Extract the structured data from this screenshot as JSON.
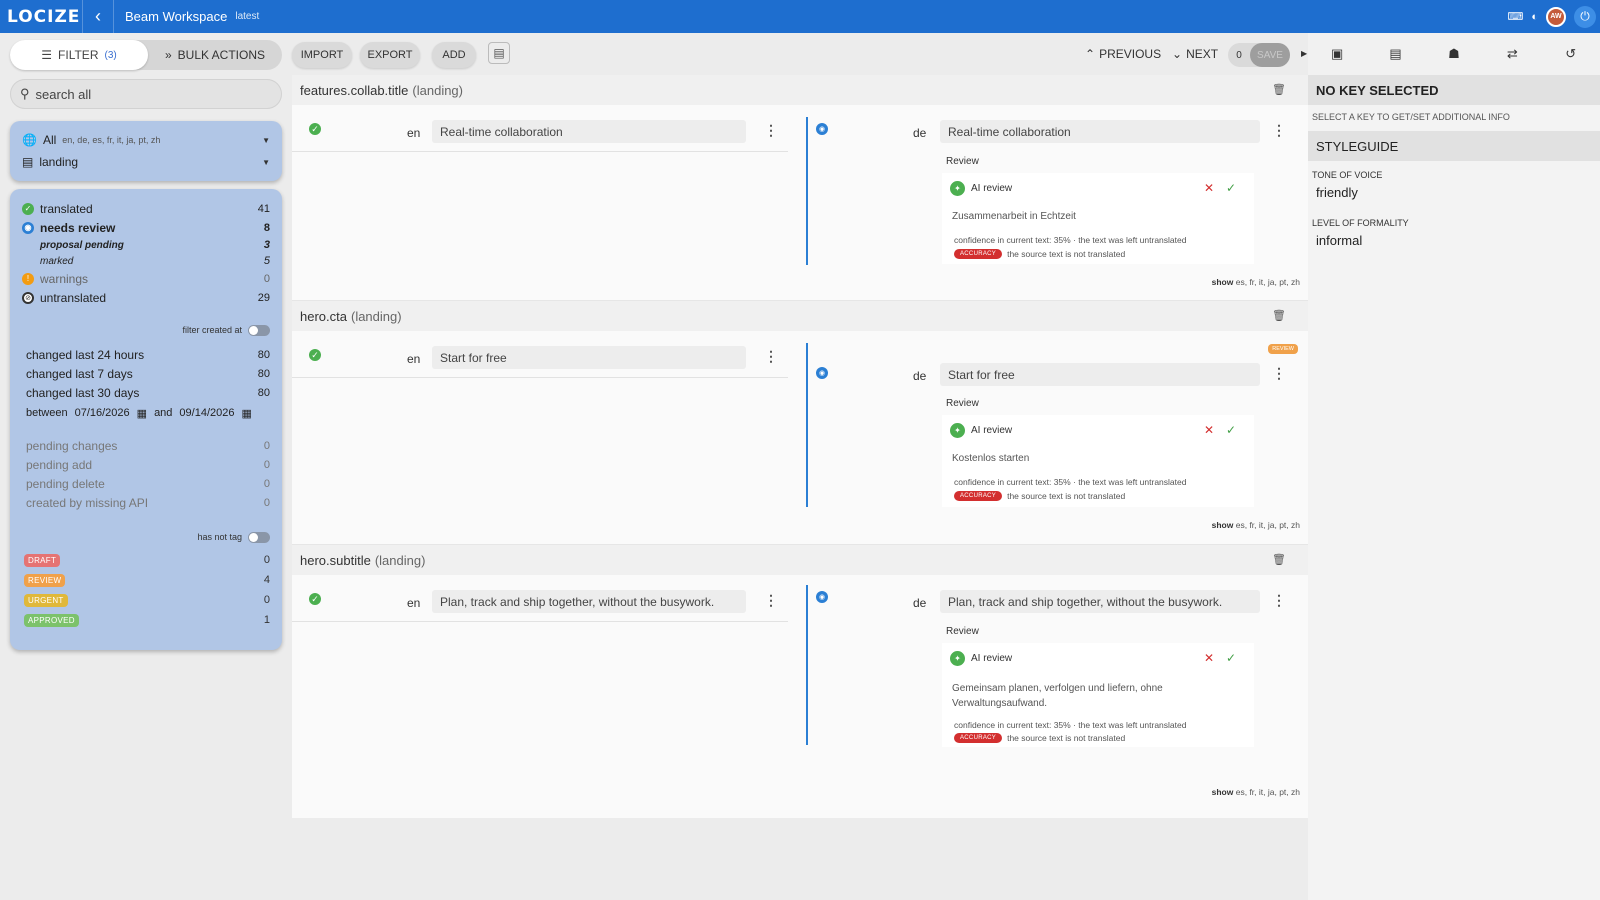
{
  "topbar": {
    "logo": "LOCIZE",
    "project": "Beam Workspace",
    "branch": "latest",
    "avatar_initials": "AW"
  },
  "sidebar": {
    "filter_label": "FILTER",
    "filter_count": "(3)",
    "bulk_label": "BULK ACTIONS",
    "search_placeholder": "search all",
    "lang_all": "All",
    "lang_list": "en, de, es, fr, it, ja, pt, zh",
    "namespace": "landing",
    "status": [
      {
        "label": "translated",
        "count": "41"
      },
      {
        "label": "needs review",
        "count": "8"
      },
      {
        "label": "proposal pending",
        "count": "3"
      },
      {
        "label": "marked",
        "count": "5"
      },
      {
        "label": "warnings",
        "count": "0"
      },
      {
        "label": "untranslated",
        "count": "29"
      }
    ],
    "filter_created_at": "filter created at",
    "changed": [
      {
        "label": "changed last 24 hours",
        "count": "80"
      },
      {
        "label": "changed last 7 days",
        "count": "80"
      },
      {
        "label": "changed last 30 days",
        "count": "80"
      }
    ],
    "between_label": "between",
    "date_from": "07/16/2026",
    "and_label": "and",
    "date_to": "09/14/2026",
    "pending": [
      {
        "label": "pending changes",
        "count": "0"
      },
      {
        "label": "pending add",
        "count": "0"
      },
      {
        "label": "pending delete",
        "count": "0"
      },
      {
        "label": "created by missing API",
        "count": "0"
      }
    ],
    "has_not_tag": "has not tag",
    "tags": [
      {
        "label": "DRAFT",
        "count": "0",
        "color": "#e57373"
      },
      {
        "label": "REVIEW",
        "count": "4",
        "color": "#f0a14a"
      },
      {
        "label": "URGENT",
        "count": "0",
        "color": "#e0b83a"
      },
      {
        "label": "APPROVED",
        "count": "1",
        "color": "#7cc26b"
      }
    ]
  },
  "toolbar": {
    "import": "IMPORT",
    "export": "EXPORT",
    "add": "ADD",
    "previous": "PREVIOUS",
    "next": "NEXT",
    "save_count": "0",
    "save": "SAVE"
  },
  "entries": [
    {
      "key": "features.collab.title",
      "ns": "(landing)",
      "src_lang": "en",
      "src_text": "Real-time collaboration",
      "tgt_lang": "de",
      "tgt_text": "Real-time collaboration",
      "review_label": "Review",
      "ai_label": "AI review",
      "ai_text": "Zusammenarbeit in Echtzeit",
      "confidence": "confidence in current text: 35% · the text was left untranslated",
      "accuracy": "ACCURACY",
      "issue": "the source text is not translated",
      "show_label": "show",
      "show_langs": "es, fr, it, ja, pt, zh"
    },
    {
      "key": "hero.cta",
      "ns": "(landing)",
      "tag": "REVIEW",
      "src_lang": "en",
      "src_text": "Start for free",
      "tgt_lang": "de",
      "tgt_text": "Start for free",
      "review_label": "Review",
      "ai_label": "AI review",
      "ai_text": "Kostenlos starten",
      "confidence": "confidence in current text: 35% · the text was left untranslated",
      "accuracy": "ACCURACY",
      "issue": "the source text is not translated",
      "show_label": "show",
      "show_langs": "es, fr, it, ja, pt, zh"
    },
    {
      "key": "hero.subtitle",
      "ns": "(landing)",
      "src_lang": "en",
      "src_text": "Plan, track and ship together, without the busywork.",
      "tgt_lang": "de",
      "tgt_text": "Plan, track and ship together, without the busywork.",
      "review_label": "Review",
      "ai_label": "AI review",
      "ai_text": "Gemeinsam planen, verfolgen und liefern, ohne Verwaltungsaufwand.",
      "confidence": "confidence in current text: 35% · the text was left untranslated",
      "accuracy": "ACCURACY",
      "issue": "the source text is not translated",
      "show_label": "show",
      "show_langs": "es, fr, it, ja, pt, zh"
    }
  ],
  "right_panel": {
    "no_key": "NO KEY SELECTED",
    "hint": "SELECT A KEY TO GET/SET ADDITIONAL INFO",
    "styleguide": "STYLEGUIDE",
    "tone_label": "TONE OF VOICE",
    "tone_value": "friendly",
    "formality_label": "LEVEL OF FORMALITY",
    "formality_value": "informal"
  },
  "colors": {
    "brand": "#1e6ecf",
    "panel": "#b1c6e6",
    "review_line": "#2b7fd4",
    "danger": "#d32f2f",
    "success": "#4caf50"
  }
}
